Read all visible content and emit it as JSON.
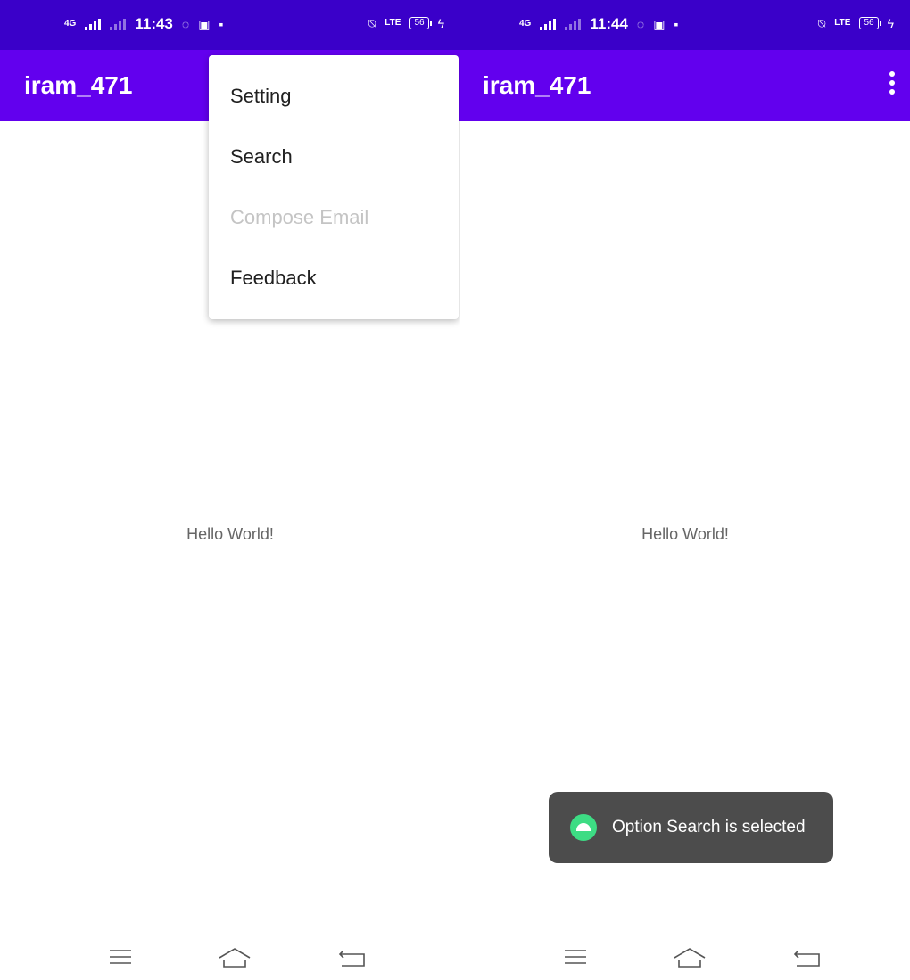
{
  "left": {
    "status": {
      "time": "11:43",
      "network": "4G",
      "battery": "56"
    },
    "app_title": "iram_471",
    "hello": "Hello World!",
    "menu": [
      {
        "label": "Setting",
        "enabled": true
      },
      {
        "label": "Search",
        "enabled": true
      },
      {
        "label": "Compose Email",
        "enabled": false
      },
      {
        "label": "Feedback",
        "enabled": true
      }
    ]
  },
  "right": {
    "status": {
      "time": "11:44",
      "network": "4G",
      "battery": "56"
    },
    "app_title": "iram_471",
    "hello": "Hello World!",
    "toast": "Option Search is selected"
  },
  "icons": [
    "overflow-menu-icon",
    "android-icon",
    "whatsapp-icon",
    "instagram-icon",
    "mute-icon",
    "battery-icon",
    "nav-menu-icon",
    "nav-home-icon",
    "nav-back-icon"
  ],
  "colors": {
    "status_bar": "#3a00c9",
    "app_bar": "#6200ee",
    "toast_bg": "#4c4c4c",
    "android_green": "#3ddc84"
  }
}
